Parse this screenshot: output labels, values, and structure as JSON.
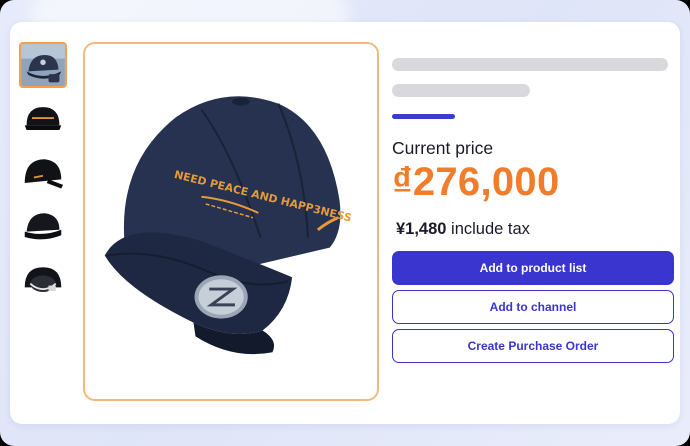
{
  "product": {
    "thumbnails": [
      {
        "icon": "cap-front-thumbnail",
        "selected": true
      },
      {
        "icon": "cap-side-thumbnail",
        "selected": false
      },
      {
        "icon": "cap-side-thumbnail",
        "selected": false
      },
      {
        "icon": "cap-top-thumbnail",
        "selected": false
      },
      {
        "icon": "cap-inside-thumbnail",
        "selected": false
      }
    ],
    "main_image_icon": "navy-baseball-cap-image",
    "cap_embroidery_text": "NEED PEACE AND HAPP3NESS",
    "price_label": "Current price",
    "price": "₫276,000",
    "tax_amount": "¥1,480",
    "tax_suffix": " include tax"
  },
  "actions": {
    "add_to_product_list": "Add to product list",
    "add_to_channel": "Add to channel",
    "create_purchase_order": "Create Purchase Order"
  },
  "colors": {
    "accent": "#3a35cf",
    "price": "#f07c2c",
    "image_border": "#f3b97a",
    "cap_navy": "#1f2a44"
  }
}
